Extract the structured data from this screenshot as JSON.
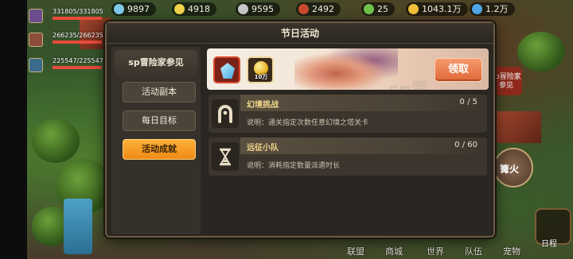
{
  "topbar": {
    "resources": [
      "9897",
      "4918",
      "9595",
      "2492",
      "25",
      "1043.1万",
      "1.2万"
    ],
    "colors": [
      "#7ecbe8",
      "#f2d34a",
      "#c9c9c9",
      "#c94c2f",
      "#6fc24a",
      "#f2c23a",
      "#4fa6e8"
    ]
  },
  "players": [
    {
      "hp": "331805/331805",
      "fill": 1.0
    },
    {
      "hp": "266235/266235",
      "fill": 1.0
    },
    {
      "hp": "225547/225547",
      "fill": 1.0
    }
  ],
  "modal": {
    "title": "节日活动",
    "sidebar": {
      "header": "sp冒险家参见",
      "tabs": [
        {
          "label": "活动副本",
          "active": false
        },
        {
          "label": "每日目标",
          "active": false
        },
        {
          "label": "活动成就",
          "active": true
        }
      ]
    },
    "banner": {
      "rewards": [
        {
          "icon": "blue-gem-icon",
          "qty": ""
        },
        {
          "icon": "gold-coin-icon",
          "qty": "10万"
        }
      ],
      "claim_label": "领取",
      "watermark": "sp冒"
    },
    "tasks": [
      {
        "icon": "horseshoe-icon",
        "name": "幻境挑战",
        "progress": "0 / 5",
        "desc": "说明：通关指定次数任意幻境之塔关卡"
      },
      {
        "icon": "hourglass-icon",
        "name": "远征小队",
        "progress": "0 / 60",
        "desc": "说明：消耗指定数量派遣时长"
      }
    ]
  },
  "right_side": {
    "sp_button": "sp冒险家参见",
    "event_button": "篝火",
    "schedule_label": "日程"
  },
  "bottom_nav": [
    "联盟",
    "商城",
    "世界",
    "队伍",
    "宠物"
  ]
}
